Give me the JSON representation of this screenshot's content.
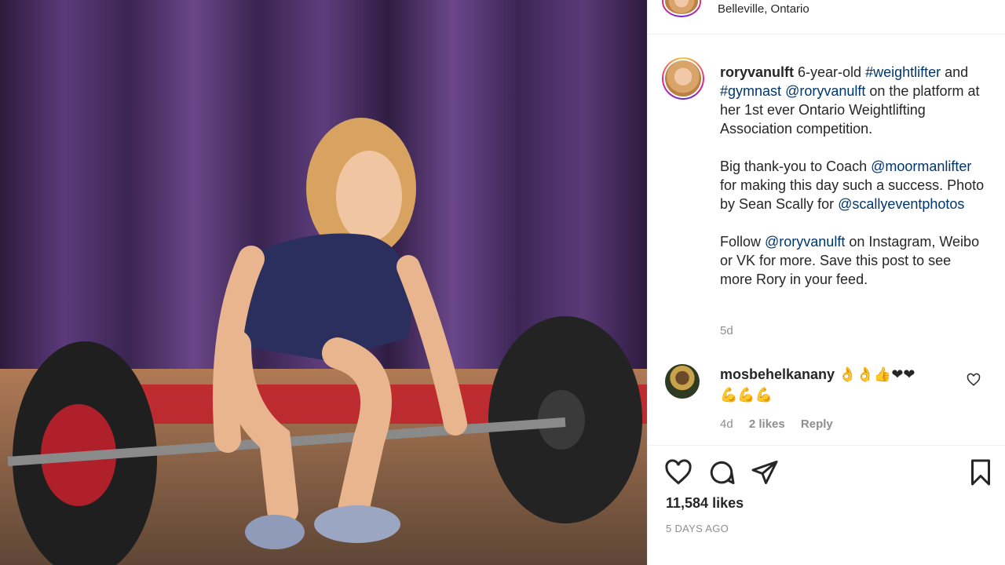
{
  "post": {
    "location": "Belleville, Ontario",
    "author": "roryvanulft",
    "caption_parts": {
      "p1_before": " 6-year-old ",
      "tag_weightlifter": "#weightlifter",
      "p1_and": " and ",
      "tag_gymnast": "#gymnast",
      "p1_sp": " ",
      "mention_rory": "@roryvanulft",
      "p1_after": " on the platform at her 1st ever Ontario Weightlifting Association competition.",
      "p2_before": "Big thank-you to Coach ",
      "mention_coach": "@moormanlifter",
      "p2_mid": " for making this day such a success. Photo by Sean Scally for ",
      "mention_photo": "@scallyeventphotos",
      "p3_before": "Follow ",
      "mention_rory2": "@roryvanulft",
      "p3_after": " on Instagram, Weibo or VK for more. Save this post to see more Rory in your feed."
    },
    "caption_time": "5d",
    "likes": "11,584 likes",
    "posted_ago": "5 DAYS AGO"
  },
  "comment": {
    "username": "mosbehelkanany",
    "emoji_line1": "👌👌👍❤❤",
    "emoji_line2": "💪💪💪",
    "time": "4d",
    "likes": "2 likes",
    "reply_label": "Reply"
  },
  "icons": {
    "like": "heart-icon",
    "comment": "comment-icon",
    "share": "send-icon",
    "save": "bookmark-icon",
    "comment_like": "small-heart-icon"
  },
  "colors": {
    "link": "#00376b",
    "muted": "#8e8e8e",
    "text": "#262626"
  }
}
